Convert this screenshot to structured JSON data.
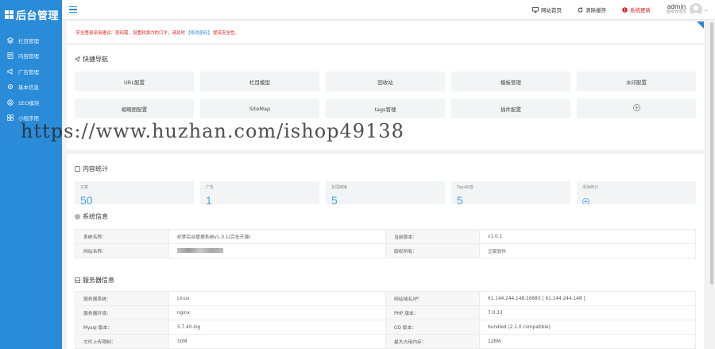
{
  "sidebar": {
    "logo": "后台管理",
    "items": [
      {
        "label": "栏目管理",
        "icon": "layers-icon"
      },
      {
        "label": "内容管理",
        "icon": "document-icon"
      },
      {
        "label": "广告管理",
        "icon": "megaphone-icon"
      },
      {
        "label": "基本信息",
        "icon": "gear-icon"
      },
      {
        "label": "SEO模块",
        "icon": "target-icon"
      },
      {
        "label": "小程序用",
        "icon": "grid-icon"
      }
    ]
  },
  "topbar": {
    "site_home": "网站首页",
    "clear_cache": "清除缓存",
    "system_update": "系统更新",
    "user_name": "admin",
    "user_role": "超级管理员"
  },
  "notice": {
    "text_before": "· 安全登录采用建议：密码需，设置较强力的口令，请及时",
    "link": "【修改密码】",
    "text_after": "提高安全性。"
  },
  "quick_nav": {
    "title": "快捷导航",
    "items": [
      "URL配置",
      "栏目模型",
      "回收站",
      "模板管理",
      "水印配置",
      "缩略图配置",
      "SiteMap",
      "tags管理",
      "插件配置",
      "+"
    ]
  },
  "stats": {
    "title": "内容统计",
    "cards": [
      {
        "label": "文章",
        "value": "50"
      },
      {
        "label": "广告",
        "value": "1"
      },
      {
        "label": "友情链接",
        "value": "5"
      },
      {
        "label": "Tags标签",
        "value": "5"
      },
      {
        "label": "添加统计",
        "value": "+"
      }
    ]
  },
  "system_info": {
    "title": "系统信息",
    "rows": [
      {
        "k1": "系统名称：",
        "v1": "织梦后台管理系统v1.0.1(完全开源)",
        "k2": "当前版本：",
        "v2": "v1.0.1"
      },
      {
        "k1": "网站名称：",
        "v1": "",
        "k2": "版权所有：",
        "v2": "正版软件"
      }
    ]
  },
  "server_info": {
    "title": "服务器信息",
    "rows": [
      {
        "k1": "服务器系统：",
        "v1": "Linux",
        "k2": "网站域名/IP：",
        "v2": "61.144.244.148:16883 [ 61.144.244.148 ]"
      },
      {
        "k1": "服务器环境：",
        "v1": "nginx",
        "k2": "PHP 版本：",
        "v2": "7.0.33"
      },
      {
        "k1": "Mysql 版本：",
        "v1": "5.7.40-log",
        "k2": "GD 版本：",
        "v2": "bundled (2.1.0 compatible)"
      },
      {
        "k1": "文件上传限制：",
        "v1": "50M",
        "k2": "最大占用内存：",
        "v2": "128M"
      }
    ]
  },
  "watermark": "https://www.huzhan.com/ishop49138",
  "colors": {
    "accent": "#2a8bd8",
    "danger": "#e02020",
    "stat_number": "#4aa3e8"
  }
}
